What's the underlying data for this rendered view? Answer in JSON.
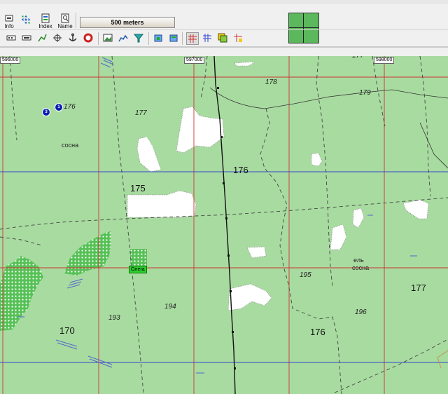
{
  "toolbar": {
    "row1": [
      {
        "name": "info-button",
        "label": "Info",
        "icon": "info-icon"
      },
      {
        "name": "pan-button",
        "label": "",
        "icon": "move-arrows-icon"
      },
      {
        "name": "index-button",
        "label": "Index",
        "icon": "index-icon"
      },
      {
        "name": "name-button",
        "label": "Name",
        "icon": "name-search-icon"
      }
    ],
    "scale_label": "500 meters"
  },
  "map": {
    "coord_labels": [
      "596000",
      "597000",
      "598000"
    ],
    "elevation_labels": [
      {
        "text": "176",
        "style": "it"
      },
      {
        "text": "177",
        "style": "it"
      },
      {
        "text": "178",
        "style": "it"
      },
      {
        "text": "179",
        "style": "it"
      },
      {
        "text": "177",
        "style": "it"
      },
      {
        "text": "175",
        "style": "big"
      },
      {
        "text": "176",
        "style": "big"
      },
      {
        "text": "195",
        "style": "it"
      },
      {
        "text": "194",
        "style": "it"
      },
      {
        "text": "193",
        "style": "it"
      },
      {
        "text": "196",
        "style": "it"
      },
      {
        "text": "170",
        "style": "big"
      },
      {
        "text": "176",
        "style": "big"
      },
      {
        "text": "177",
        "style": "big"
      }
    ],
    "vegetation_labels": [
      "сосна",
      "ель",
      "сосна"
    ],
    "waypoint_label": "Олега",
    "markers": [
      "1",
      "3"
    ]
  },
  "colors": {
    "land": "#a8dba0",
    "forest": "#5cc25a",
    "grid_red": "#cc3333",
    "grid_blue": "#3344cc",
    "waypoint": "#2ecc2e"
  }
}
